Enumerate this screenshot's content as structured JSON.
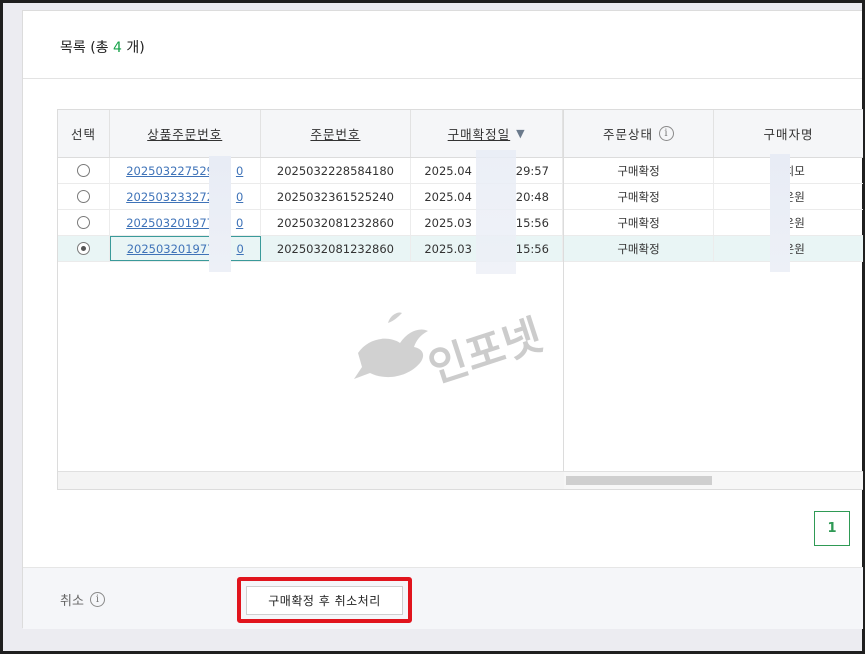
{
  "list": {
    "title_prefix": "목록 (총 ",
    "count": "4",
    "title_suffix": " 개)"
  },
  "columns": {
    "select": "선택",
    "product_order_no": "상품주문번호",
    "order_no": "주문번호",
    "confirm_date": "구매확정일",
    "order_status": "주문상태",
    "buyer_name": "구매자명"
  },
  "rows": [
    {
      "product_order_no": "202503227529___0",
      "order_no": "2025032228584180",
      "confirm_date": "2025.04_____29:57",
      "status": "구매확정",
      "buyer": "__희모",
      "selected": false
    },
    {
      "product_order_no": "202503233272___0",
      "order_no": "2025032361525240",
      "confirm_date": "2025.04_____20:48",
      "status": "구매확정",
      "buyer": "__은원",
      "selected": false
    },
    {
      "product_order_no": "202503201977___0",
      "order_no": "2025032081232860",
      "confirm_date": "2025.03_____15:56",
      "status": "구매확정",
      "buyer": "__은원",
      "selected": false
    },
    {
      "product_order_no": "202503201977___0",
      "order_no": "2025032081232860",
      "confirm_date": "2025.03_____15:56",
      "status": "구매확정",
      "buyer": "__은원",
      "selected": true
    }
  ],
  "rows_display": {
    "r0": {
      "pno": "202503227529",
      "pno_tail": "0",
      "date_head": "2025.04",
      "date_tail": "29:57",
      "buyer_tail": "희모"
    },
    "r1": {
      "pno": "202503233272",
      "pno_tail": "0",
      "date_head": "2025.04",
      "date_tail": "20:48",
      "buyer_tail": "은원"
    },
    "r2": {
      "pno": "202503201977",
      "pno_tail": "0",
      "date_head": "2025.03",
      "date_tail": "15:56",
      "buyer_tail": "은원"
    },
    "r3": {
      "pno": "202503201977",
      "pno_tail": "0",
      "date_head": "2025.03",
      "date_tail": "15:56",
      "buyer_tail": "은원"
    }
  },
  "pagination": {
    "current": "1"
  },
  "bottom": {
    "cancel_label": "취소",
    "cancel_button": "구매확정 후 취소처리"
  },
  "watermark": {
    "text": "인포넷"
  },
  "colors": {
    "accent_green": "#17a34a",
    "highlight_red": "#e1141d",
    "link_blue": "#3f73b8"
  }
}
